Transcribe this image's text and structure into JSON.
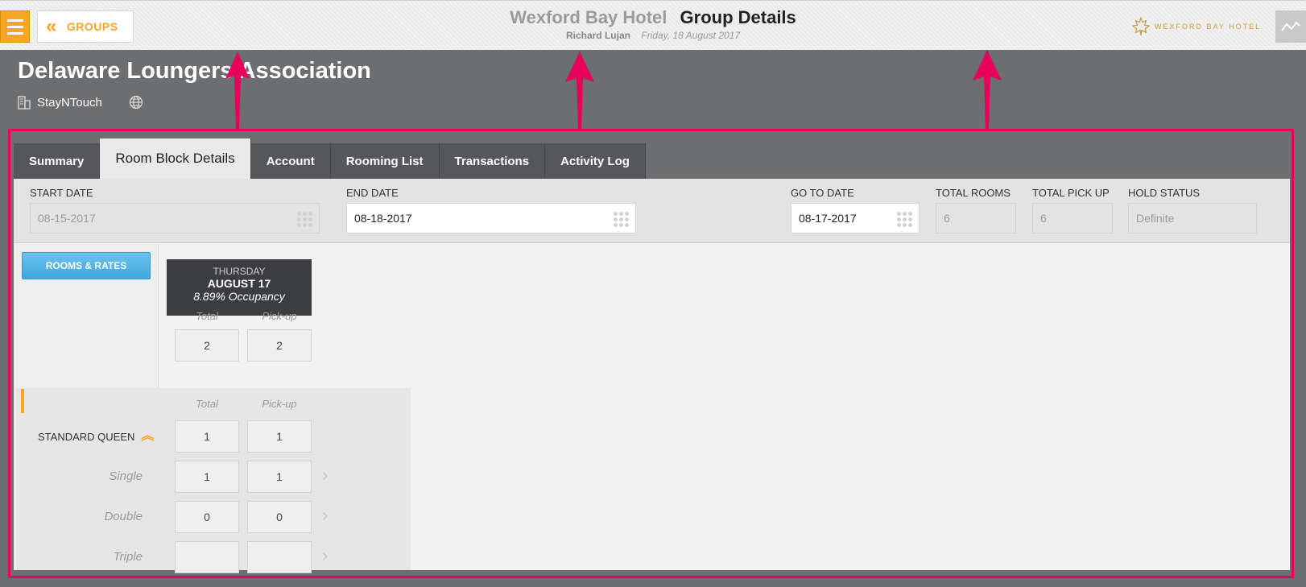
{
  "topbar": {
    "groups_label": "GROUPS",
    "hotel_name": "Wexford Bay Hotel",
    "page_title": "Group Details",
    "user": "Richard Lujan",
    "date": "Friday, 18 August 2017",
    "logo_text": "WEXFORD BAY HOTEL"
  },
  "group": {
    "name": "Delaware Loungers Association",
    "company": "StayNTouch"
  },
  "tabs": [
    "Summary",
    "Room Block Details",
    "Account",
    "Rooming List",
    "Transactions",
    "Activity Log"
  ],
  "filters": {
    "start_date_label": "START DATE",
    "start_date": "08-15-2017",
    "end_date_label": "END DATE",
    "end_date": "08-18-2017",
    "go_to_date_label": "GO TO DATE",
    "go_to_date": "08-17-2017",
    "total_rooms_label": "TOTAL ROOMS",
    "total_rooms": "6",
    "total_pickup_label": "TOTAL PICK UP",
    "total_pickup": "6",
    "hold_status_label": "HOLD STATUS",
    "hold_status": "Definite"
  },
  "rooms_rates_label": "ROOMS & RATES",
  "date_card": {
    "weekday": "THURSDAY",
    "date": "AUGUST 17",
    "occupancy": "8.89% Occupancy"
  },
  "columns": {
    "total": "Total",
    "pickup": "Pick-up"
  },
  "summary_row": {
    "total": "2",
    "pickup": "2"
  },
  "room_type": {
    "name": "STANDARD QUEEN",
    "total": "1",
    "pickup": "1",
    "occupancies": [
      {
        "label": "Single",
        "total": "1",
        "pickup": "1"
      },
      {
        "label": "Double",
        "total": "0",
        "pickup": "0"
      },
      {
        "label": "Triple",
        "total": "",
        "pickup": ""
      }
    ]
  },
  "colors": {
    "accent": "#f6a623",
    "annotation": "#e6005c",
    "button_blue": "#4aaee4"
  },
  "icons": [
    "menu-icon",
    "double-chevron-left-icon",
    "maple-leaf-icon",
    "activity-graph-icon",
    "building-icon",
    "globe-icon",
    "calendar-grid-icon",
    "double-chevron-up-icon",
    "chevron-right-icon"
  ]
}
